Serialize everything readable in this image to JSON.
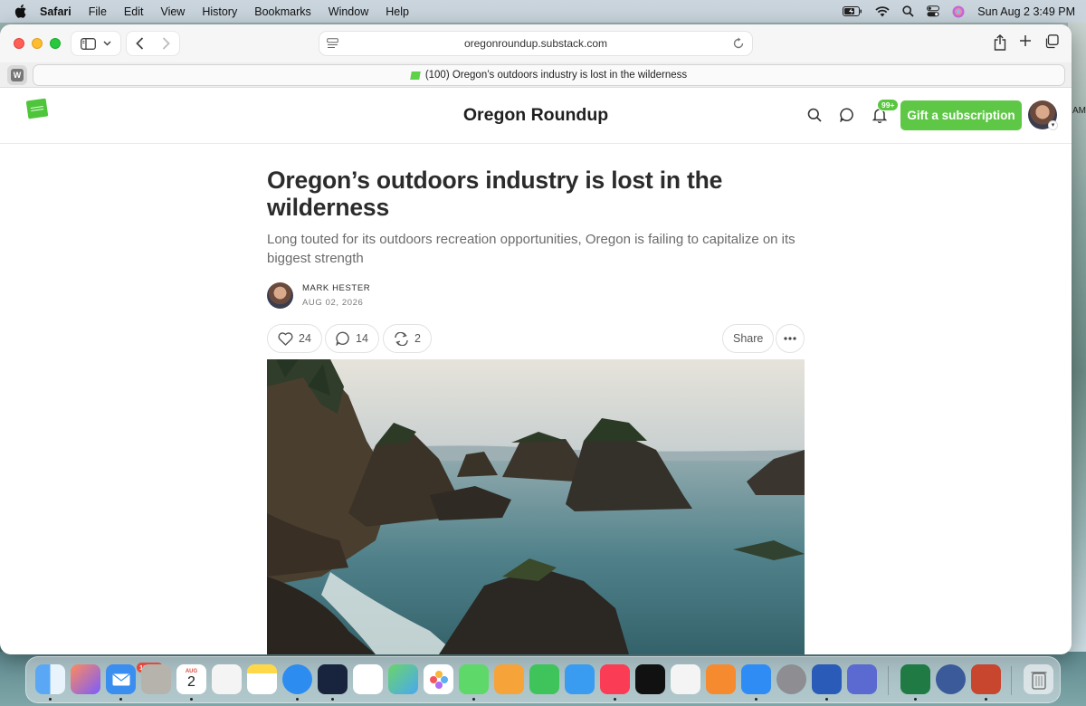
{
  "menubar": {
    "app_name": "Safari",
    "items": [
      "File",
      "Edit",
      "View",
      "History",
      "Bookmarks",
      "Window",
      "Help"
    ],
    "clock": "Sun Aug 2  3:49 PM"
  },
  "browser": {
    "url": "oregonroundup.substack.com",
    "tab_title": "(100) Oregon’s outdoors industry is lost in the wilderness",
    "left_tab_letter": "W"
  },
  "site": {
    "title": "Oregon Roundup",
    "notification_count": "99+",
    "gift_button": "Gift a subscription"
  },
  "article": {
    "title": "Oregon’s outdoors industry is lost in the wilderness",
    "subtitle": "Long touted for its outdoors recreation opportunities, Oregon is failing to capitalize on its biggest strength",
    "author": "MARK HESTER",
    "date": "AUG 02, 2026",
    "likes": "24",
    "comments": "14",
    "restacks": "2",
    "share_label": "Share"
  },
  "desktop": {
    "edge_text": "AM"
  },
  "dock": {
    "mail_badge": "19,979",
    "calendar_day": "2",
    "calendar_month": "AUG"
  }
}
